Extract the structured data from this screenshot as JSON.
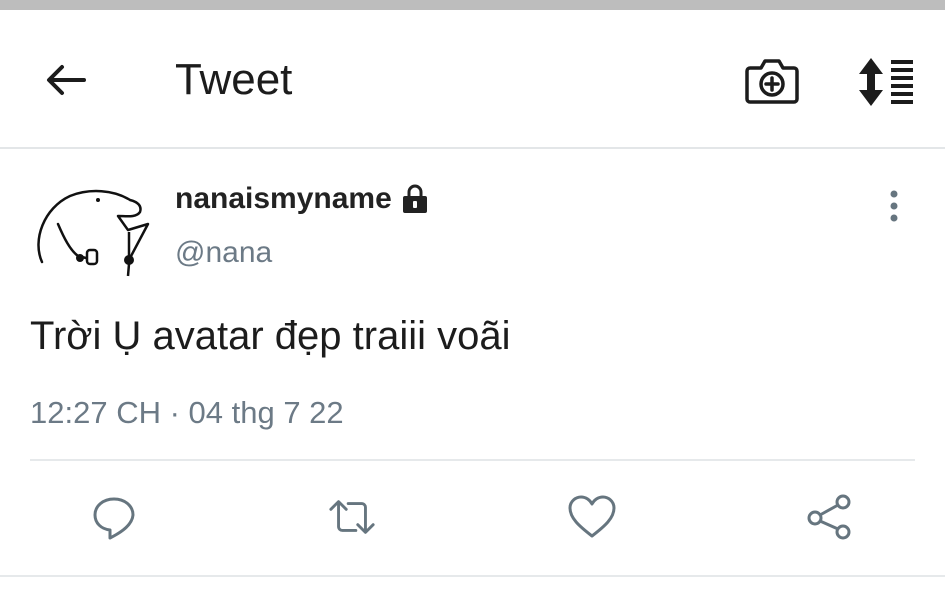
{
  "header": {
    "title": "Tweet",
    "back_icon": "arrow-left-icon",
    "camera_icon": "camera-plus-icon",
    "sort_icon": "sort-list-icon"
  },
  "tweet": {
    "display_name": "nanaismyname",
    "handle": "@nana",
    "protected_icon": "lock-icon",
    "text": "Trời Ụ avatar đẹp traiii voãi",
    "timestamp": "12:27 CH · 04 thg 7 22"
  },
  "actions": {
    "reply_icon": "reply-icon",
    "retweet_icon": "retweet-icon",
    "like_icon": "heart-icon",
    "share_icon": "share-icon"
  },
  "colors": {
    "text": "#1c1c1c",
    "muted": "#6c7a86",
    "icon": "#66757f",
    "divider": "#e6e9eb"
  }
}
